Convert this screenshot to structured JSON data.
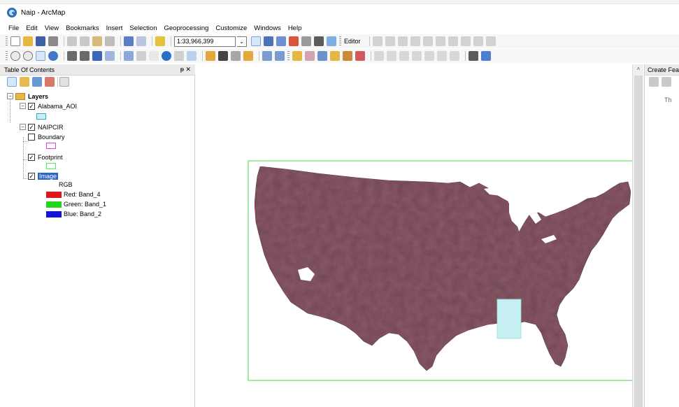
{
  "window": {
    "title": "Naip - ArcMap"
  },
  "menu": [
    "File",
    "Edit",
    "View",
    "Bookmarks",
    "Insert",
    "Selection",
    "Geoprocessing",
    "Customize",
    "Windows",
    "Help"
  ],
  "toolbar": {
    "scale_value": "1:33,966,399",
    "editor_label": "Editor"
  },
  "toc": {
    "title": "Table Of Contents",
    "root_label": "Layers",
    "layers": {
      "alabama_aoi": "Alabama_AOI",
      "naipcir": "NAIPCIR",
      "boundary": "Boundary",
      "footprint": "Footprint",
      "image": "Image"
    },
    "legend": {
      "rgb": "RGB",
      "red": "Red:   Band_4",
      "green": "Green: Band_1",
      "blue": "Blue:  Band_2"
    },
    "colors": {
      "alabama_fill": "#c8f0f5",
      "boundary_outline": "#e23fd6",
      "footprint_outline": "#56e556",
      "red": "#e0161b",
      "green": "#21d61d",
      "blue": "#1414d8"
    }
  },
  "map": {
    "footprint_color": "#66e066",
    "land_color": "#8a5a68",
    "aoi_color": "#c6f0f2"
  },
  "create_features": {
    "title": "Create Feat",
    "hint": "Th"
  }
}
